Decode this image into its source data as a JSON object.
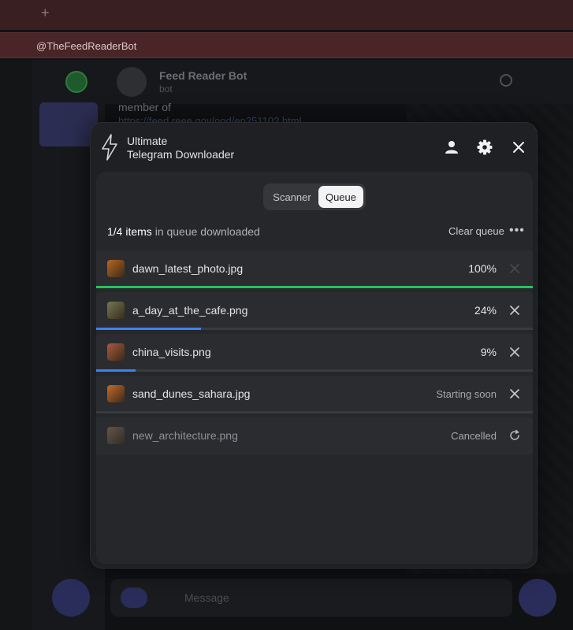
{
  "background": {
    "url": "@TheFeedReaderBot",
    "chat_title": "Feed Reader Bot",
    "chat_subtitle": "bot",
    "message_line1": "member of",
    "message_line2": "https://feed.reee.gov/ood/ep25110?.html",
    "compose_placeholder": "Message",
    "tab_plus": "+"
  },
  "modal": {
    "title_line1": "Ultimate",
    "title_line2": "Telegram Downloader",
    "tabs": {
      "scanner": "Scanner",
      "queue": "Queue",
      "active": "queue"
    },
    "summary": {
      "count": "1/4 items",
      "rest": " in queue downloaded"
    },
    "clear_queue": "Clear queue",
    "more": "•••",
    "items": [
      {
        "name": "dawn_latest_photo.jpg",
        "status": "100%",
        "progress": 1.0,
        "bar_color": "#22c55e",
        "action": "close",
        "thumb": "#b8651f"
      },
      {
        "name": "a_day_at_the_cafe.png",
        "status": "24%",
        "progress": 0.24,
        "bar_color": "#3b82f6",
        "action": "close",
        "thumb": "#6f7a55"
      },
      {
        "name": "china_visits.png",
        "status": "9%",
        "progress": 0.09,
        "bar_color": "#3b82f6",
        "action": "close",
        "thumb": "#a85a3c"
      },
      {
        "name": "sand_dunes_sahara.jpg",
        "status": "Starting soon",
        "progress": 0,
        "bar_color": "#3b82f6",
        "action": "close",
        "thumb": "#c46a2a"
      },
      {
        "name": "new_architecture.png",
        "status": "Cancelled",
        "progress": null,
        "bar_color": "",
        "action": "retry",
        "thumb": "#9a8060"
      }
    ]
  },
  "colors": {
    "accent_green": "#22c55e",
    "accent_blue": "#3b82f6"
  }
}
